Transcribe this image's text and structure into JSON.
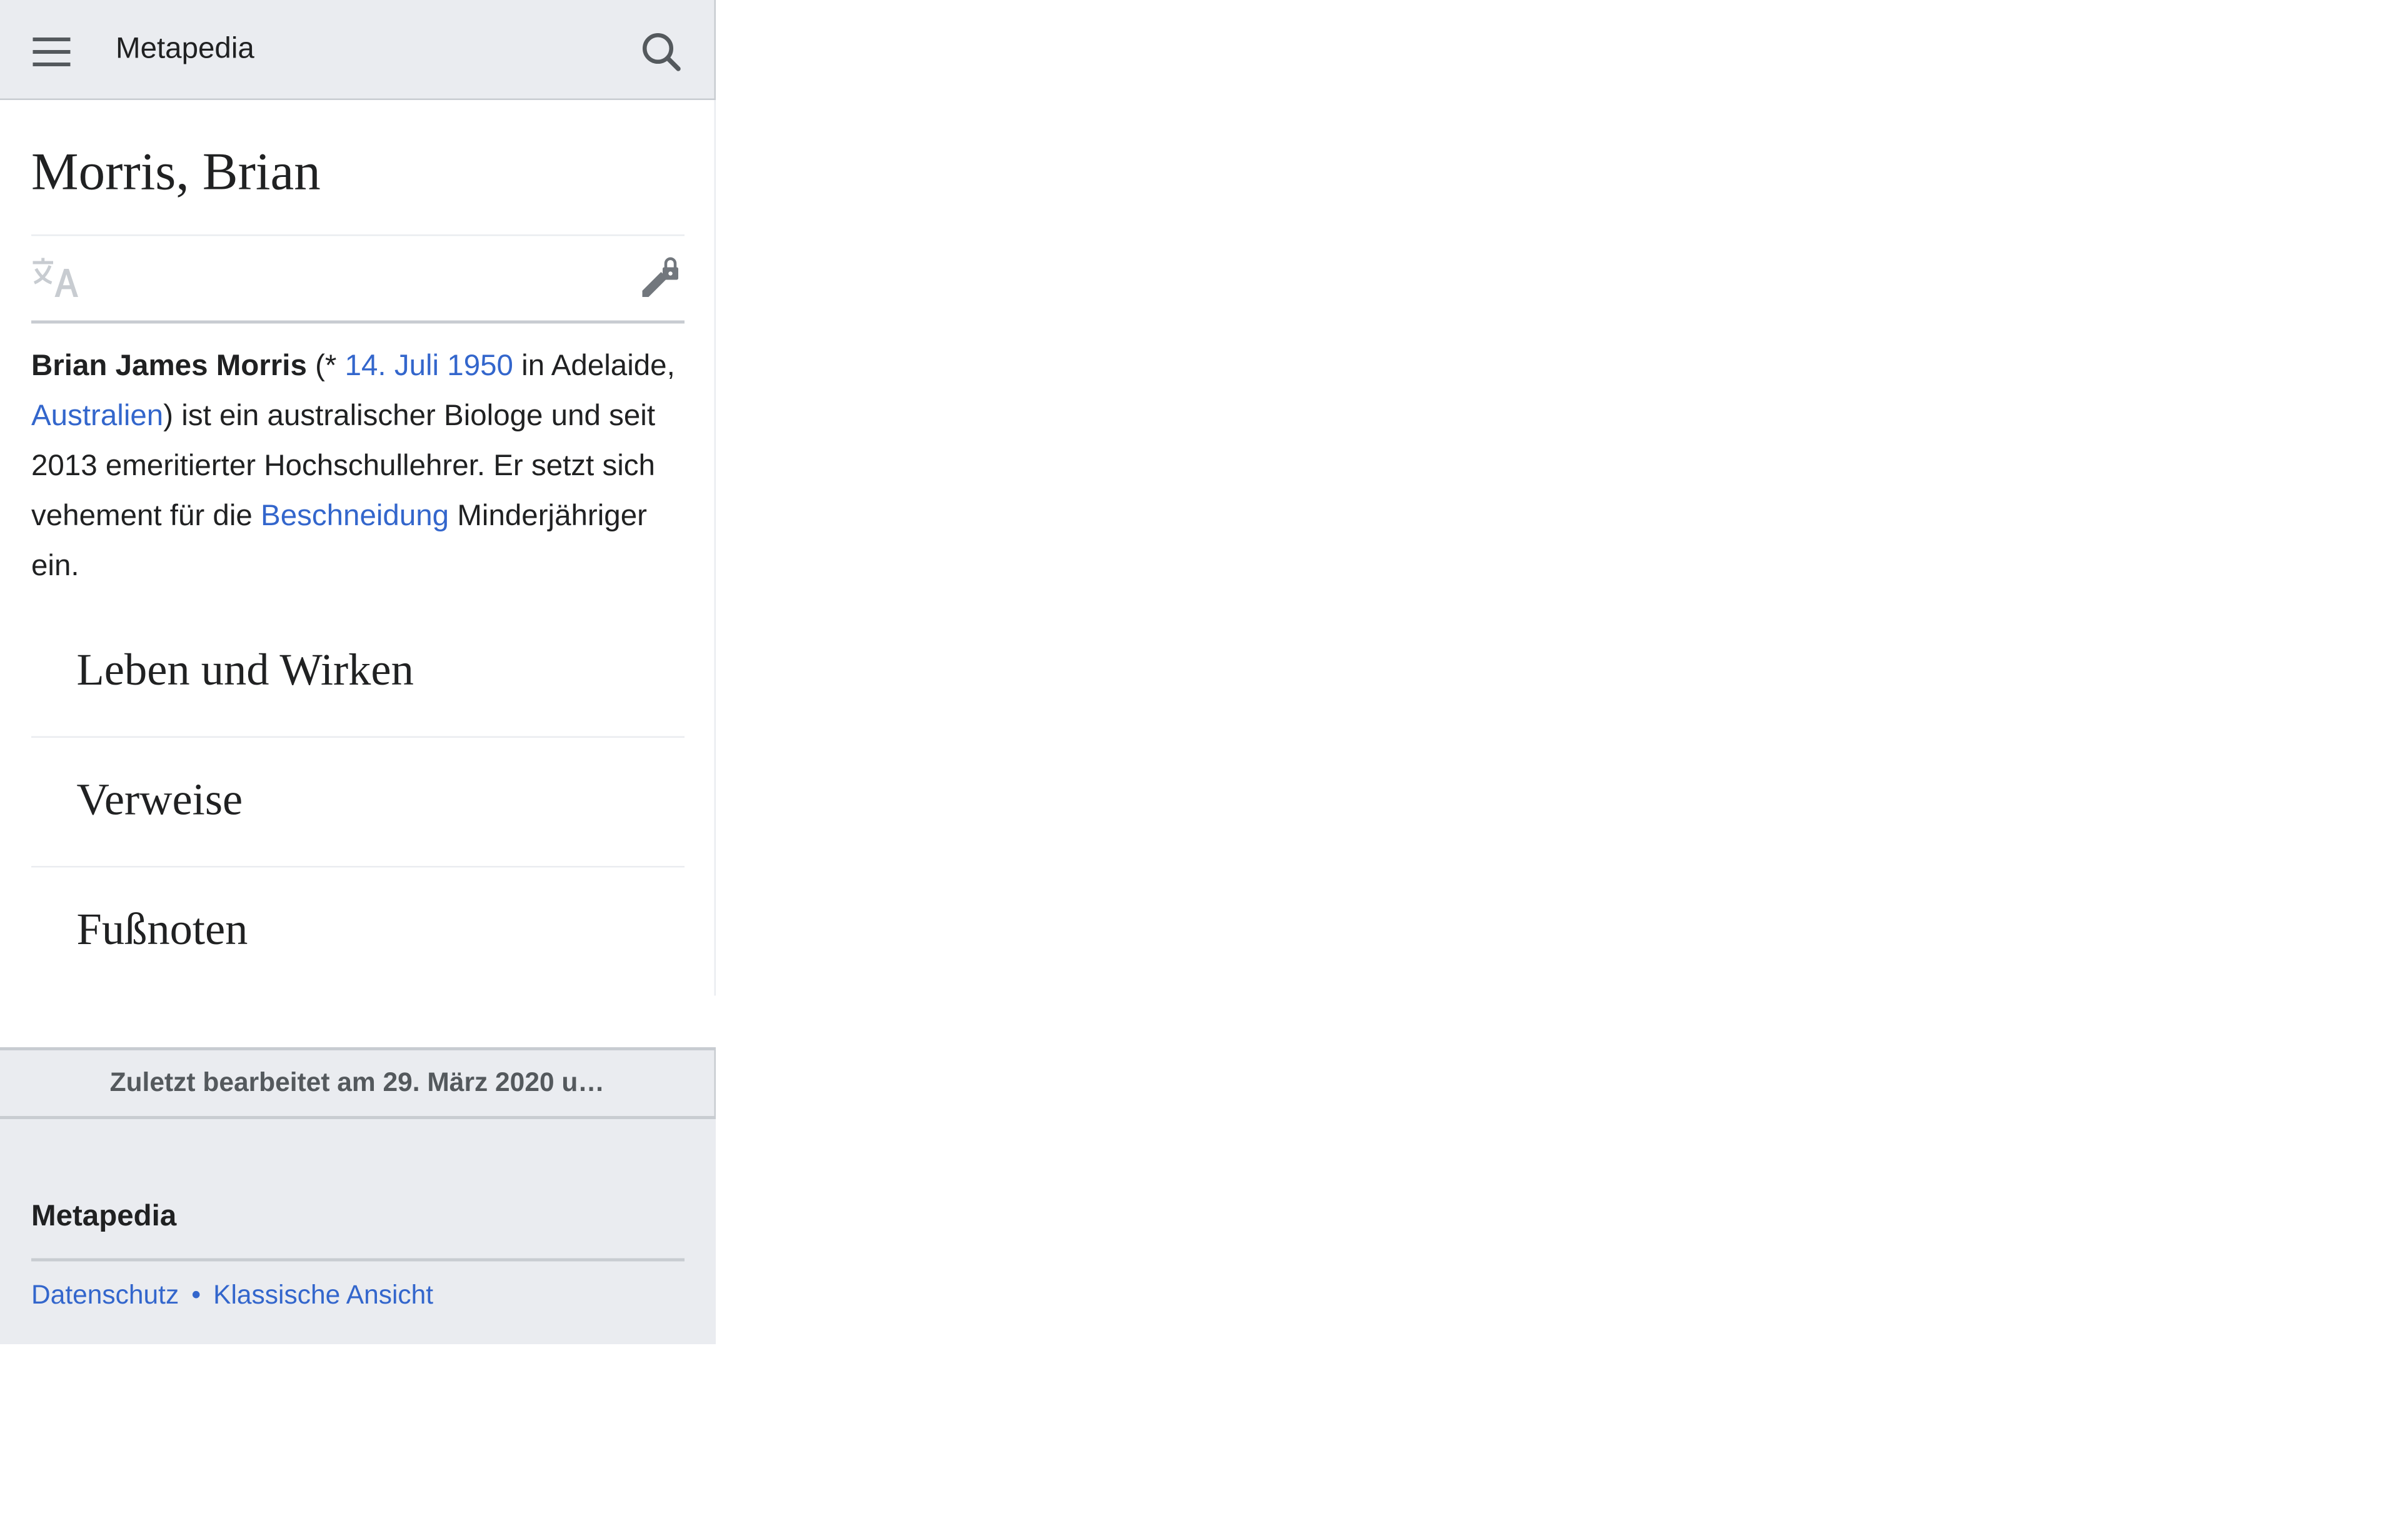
{
  "header": {
    "site_name": "Metapedia",
    "menu_icon": "hamburger-menu-icon",
    "search_icon": "search-icon"
  },
  "article": {
    "title": "Morris, Brian",
    "language_icon": "language-icon",
    "edit_icon": "edit-locked-icon",
    "lead": {
      "name_bold": "Brian James Morris",
      "t1": " (* ",
      "link_date": "14. Juli 1950",
      "t2": " in Adelaide, ",
      "link_country": "Australien",
      "t3": ") ist ein australischer Biologe und seit 2013 emeritierter Hochschullehrer. Er setzt sich vehement für die ",
      "link_circumcision": "Beschneidung",
      "t4": " Minderjähriger ein."
    },
    "sections": [
      {
        "title": "Leben und Wirken"
      },
      {
        "title": "Verweise"
      },
      {
        "title": "Fußnoten"
      }
    ]
  },
  "last_modified": "Zuletzt bearbeitet am 29. März 2020 u…",
  "footer": {
    "site_name": "Metapedia",
    "links": [
      "Datenschutz",
      "Klassische Ansicht"
    ],
    "separator": "•"
  },
  "colors": {
    "link": "#3366cc",
    "text": "#202122",
    "chrome_bg": "#eaecf0",
    "border": "#c8ccd1"
  }
}
